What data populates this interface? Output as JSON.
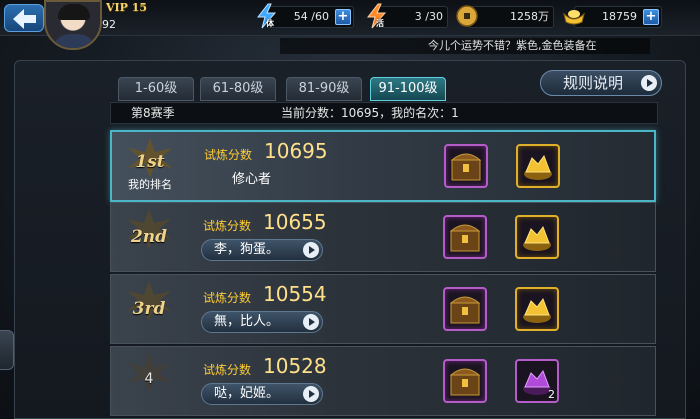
{
  "header": {
    "vip": "VIP 15",
    "level": "92",
    "stamina": "54 /60",
    "stamina_tag": "体",
    "vitality": "3 /30",
    "vitality_tag": "活",
    "coins": "1258万",
    "ingots": "18759"
  },
  "marquee": "今儿个运势不错？紫色,金色装备在",
  "tabs": [
    {
      "label": "1-60级",
      "active": false
    },
    {
      "label": "61-80级",
      "active": false
    },
    {
      "label": "81-90级",
      "active": false
    },
    {
      "label": "91-100级",
      "active": true
    }
  ],
  "rules_label": "规则说明",
  "season": {
    "label": "第8赛季",
    "current": "当前分数：10695，我的名次：1"
  },
  "score_label": "试炼分数",
  "rows": [
    {
      "rank": "1st",
      "sub": "我的排名",
      "score": "10695",
      "name": "修心者",
      "reward2": "gold",
      "reward2_count": ""
    },
    {
      "rank": "2nd",
      "score": "10655",
      "name": "李，狗蛋。",
      "reward2": "gold",
      "reward2_count": ""
    },
    {
      "rank": "3rd",
      "score": "10554",
      "name": "無，比人。",
      "reward2": "gold",
      "reward2_count": ""
    },
    {
      "rank": "4",
      "score": "10528",
      "name": "哒，妃姬。",
      "reward2": "purple",
      "reward2_count": "2"
    }
  ],
  "colors": {
    "accent": "#4bb7c6",
    "score": "#ffcc33",
    "chest_border": "#b45cc8",
    "gold_border": "#e0b02a"
  }
}
